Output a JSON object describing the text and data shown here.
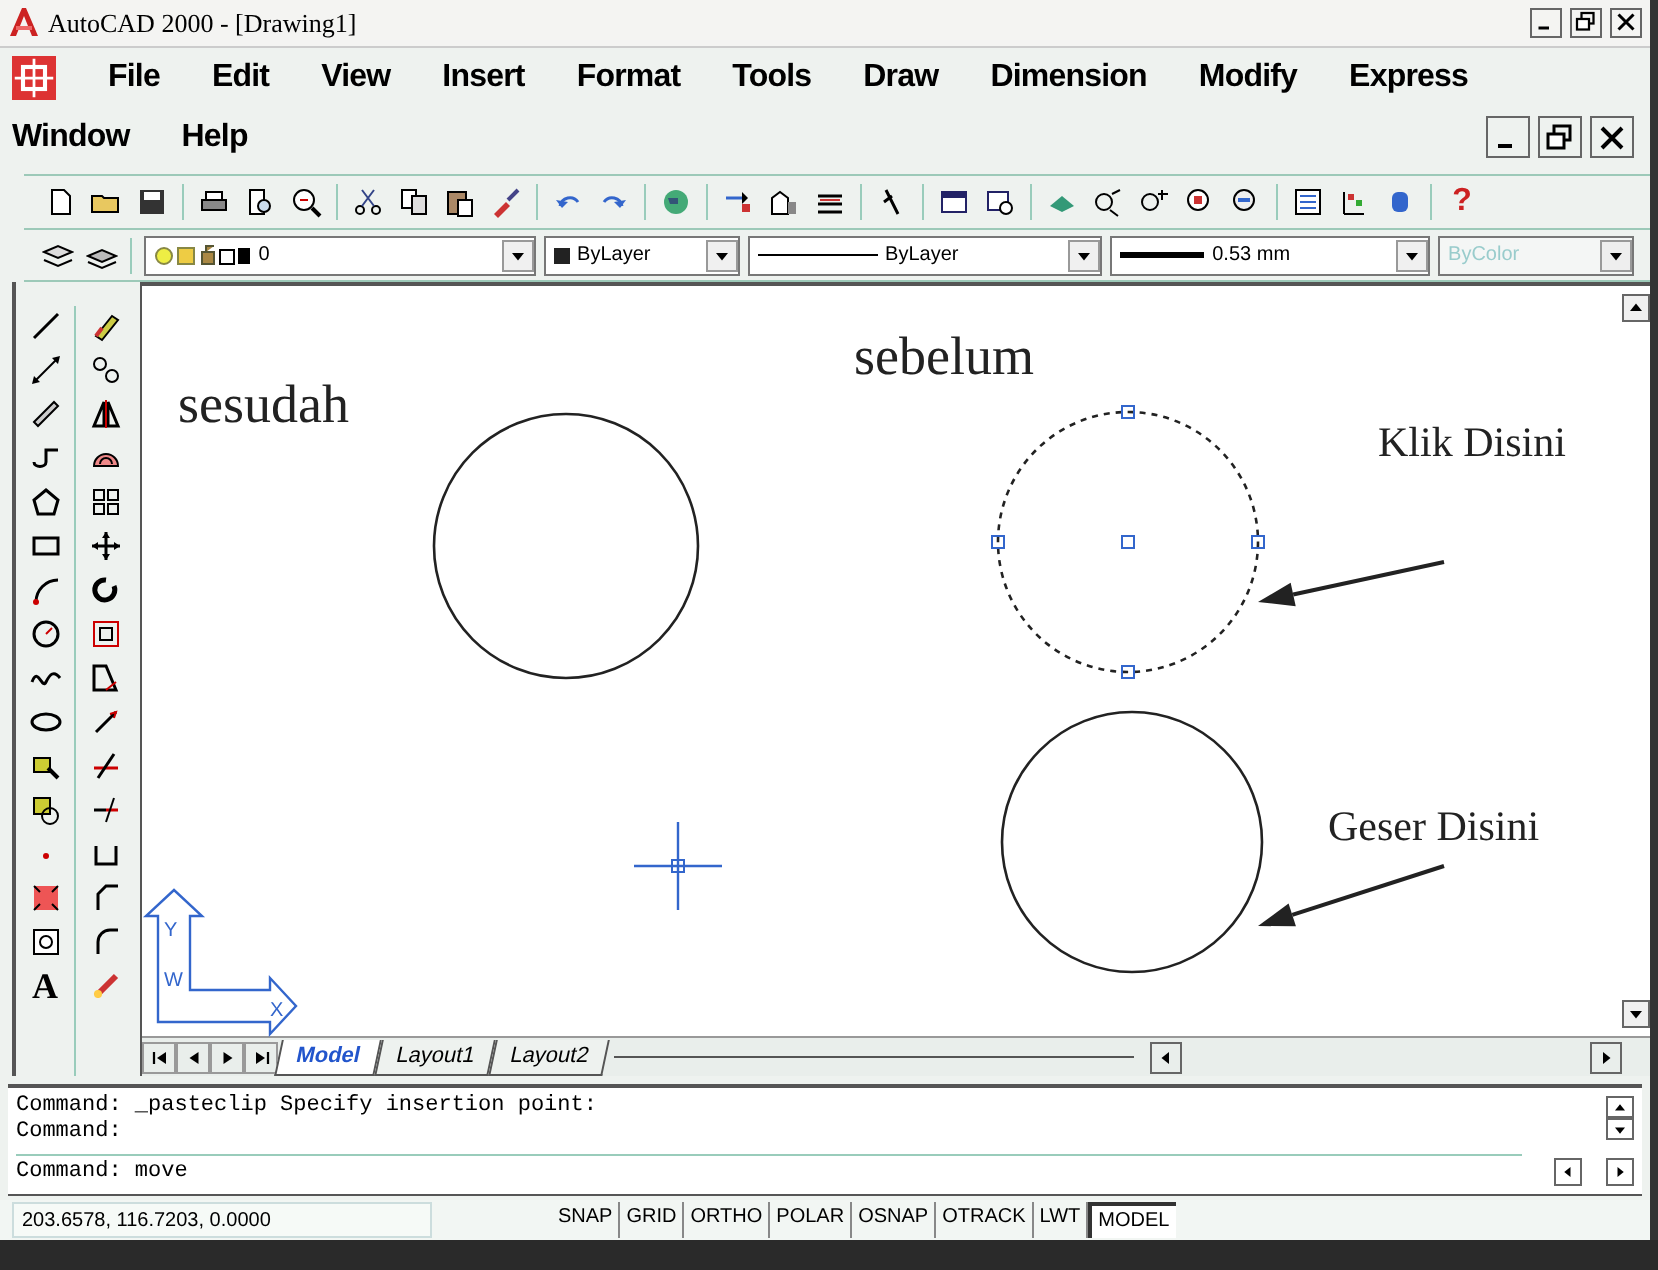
{
  "window": {
    "title": "AutoCAD 2000 - [Drawing1]"
  },
  "menu_bar": {
    "rows": [
      [
        "File",
        "Edit",
        "View",
        "Insert",
        "Format",
        "Tools",
        "Draw",
        "Dimension",
        "Modify",
        "Express"
      ],
      [
        "Window",
        "Help"
      ]
    ]
  },
  "standard_toolbar": {
    "help_glyph": "?"
  },
  "properties_bar": {
    "layer": "0",
    "color_control": "ByLayer",
    "linetype": "ByLayer",
    "lineweight": "0.53 mm",
    "plot_style": {
      "value": "ByColor",
      "disabled": true
    }
  },
  "draw_toolbar": {
    "text_glyph": "A"
  },
  "canvas": {
    "labels": [
      "sesudah",
      "sebelum",
      "Klik Disini",
      "Geser Disini"
    ],
    "objects": [
      {
        "kind": "circle",
        "selected": false
      },
      {
        "kind": "circle",
        "selected": true
      },
      {
        "kind": "circle",
        "selected": false
      }
    ],
    "ucs_icon": {
      "y_label": "Y",
      "w_label": "W",
      "x_label": "X"
    }
  },
  "layout_tabs": [
    {
      "label": "Model",
      "selected": true
    },
    {
      "label": "Layout1",
      "selected": false
    },
    {
      "label": "Layout2",
      "selected": false
    }
  ],
  "command_window": {
    "history": [
      "Command: _pasteclip Specify insertion point:",
      "Command:"
    ],
    "prompt": "Command: move"
  },
  "status_bar": {
    "coordinates": "203.6578, 116.7203, 0.0000",
    "toggles": [
      {
        "label": "SNAP",
        "pressed": false
      },
      {
        "label": "GRID",
        "pressed": false
      },
      {
        "label": "ORTHO",
        "pressed": false
      },
      {
        "label": "POLAR",
        "pressed": false
      },
      {
        "label": "OSNAP",
        "pressed": false
      },
      {
        "label": "OTRACK",
        "pressed": false
      },
      {
        "label": "LWT",
        "pressed": false
      },
      {
        "label": "MODEL",
        "pressed": true
      }
    ]
  }
}
